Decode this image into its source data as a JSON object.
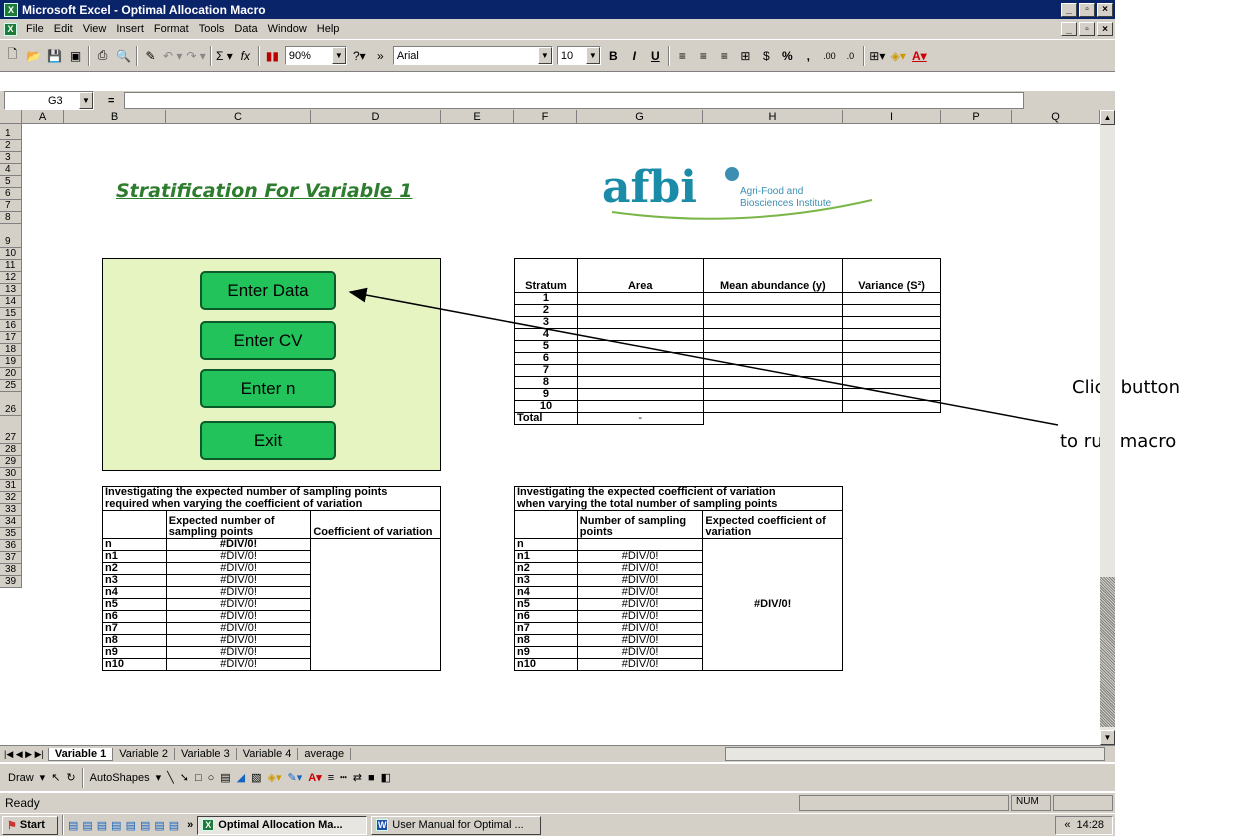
{
  "window": {
    "title": "Microsoft Excel - Optimal Allocation Macro"
  },
  "menu": [
    "File",
    "Edit",
    "View",
    "Insert",
    "Format",
    "Tools",
    "Data",
    "Window",
    "Help"
  ],
  "toolbar": {
    "zoom": "90%",
    "font": "Arial",
    "font_size": "10"
  },
  "formula_bar": {
    "name_box": "G3",
    "equals": "="
  },
  "columns": [
    "A",
    "B",
    "C",
    "D",
    "E",
    "F",
    "G",
    "H",
    "I",
    "P",
    "Q"
  ],
  "rows": [
    "1",
    "2",
    "3",
    "4",
    "5",
    "6",
    "7",
    "8",
    "9",
    "10",
    "11",
    "12",
    "13",
    "14",
    "15",
    "16",
    "17",
    "18",
    "19",
    "20",
    "25",
    "26",
    "27",
    "28",
    "29",
    "30",
    "31",
    "32",
    "33",
    "34",
    "35",
    "36",
    "37",
    "38",
    "39"
  ],
  "sheet": {
    "heading": "Stratification For Variable 1",
    "logo": {
      "text": "afbi",
      "line1": "Agri-Food and",
      "line2": "Biosciences Institute"
    },
    "buttons": [
      "Enter Data",
      "Enter CV",
      "Enter n",
      "Exit"
    ],
    "strata_table": {
      "headers": [
        "Stratum",
        "Area",
        "Mean abundance (y)",
        "Variance (S²)"
      ],
      "rows": [
        "1",
        "2",
        "3",
        "4",
        "5",
        "6",
        "7",
        "8",
        "9",
        "10"
      ],
      "total_label": "Total",
      "total_value": "-"
    },
    "left_table": {
      "title_line1": "Investigating the expected number of sampling points",
      "title_line2": "required when varying the coefficient of variation",
      "col1": "Expected number of sampling points",
      "col2": "Coefficient of variation",
      "rows": [
        {
          "label": "n",
          "value": "#DIV/0!"
        },
        {
          "label": "n1",
          "value": "#DIV/0!"
        },
        {
          "label": "n2",
          "value": "#DIV/0!"
        },
        {
          "label": "n3",
          "value": "#DIV/0!"
        },
        {
          "label": "n4",
          "value": "#DIV/0!"
        },
        {
          "label": "n5",
          "value": "#DIV/0!"
        },
        {
          "label": "n6",
          "value": "#DIV/0!"
        },
        {
          "label": "n7",
          "value": "#DIV/0!"
        },
        {
          "label": "n8",
          "value": "#DIV/0!"
        },
        {
          "label": "n9",
          "value": "#DIV/0!"
        },
        {
          "label": "n10",
          "value": "#DIV/0!"
        }
      ]
    },
    "right_table": {
      "title_line1": "Investigating the expected coefficient of variation",
      "title_line2": "when varying the total number of sampling points",
      "col1": "Number of sampling points",
      "col2": "Expected coefficient of variation",
      "cv_value": "#DIV/0!",
      "rows": [
        {
          "label": "n",
          "value": ""
        },
        {
          "label": "n1",
          "value": "#DIV/0!"
        },
        {
          "label": "n2",
          "value": "#DIV/0!"
        },
        {
          "label": "n3",
          "value": "#DIV/0!"
        },
        {
          "label": "n4",
          "value": "#DIV/0!"
        },
        {
          "label": "n5",
          "value": "#DIV/0!"
        },
        {
          "label": "n6",
          "value": "#DIV/0!"
        },
        {
          "label": "n7",
          "value": "#DIV/0!"
        },
        {
          "label": "n8",
          "value": "#DIV/0!"
        },
        {
          "label": "n9",
          "value": "#DIV/0!"
        },
        {
          "label": "n10",
          "value": "#DIV/0!"
        }
      ]
    }
  },
  "annotation": {
    "line1": "Click button",
    "line2": "to run macro"
  },
  "sheet_tabs": [
    "Variable 1",
    "Variable 2",
    "Variable 3",
    "Variable 4",
    "average"
  ],
  "drawing_toolbar": {
    "draw": "Draw",
    "autoshapes": "AutoShapes"
  },
  "status": {
    "text": "Ready",
    "num": "NUM"
  },
  "taskbar": {
    "start": "Start",
    "tasks": [
      "Optimal Allocation Ma...",
      "User Manual for Optimal ..."
    ],
    "clock": "14:28"
  }
}
